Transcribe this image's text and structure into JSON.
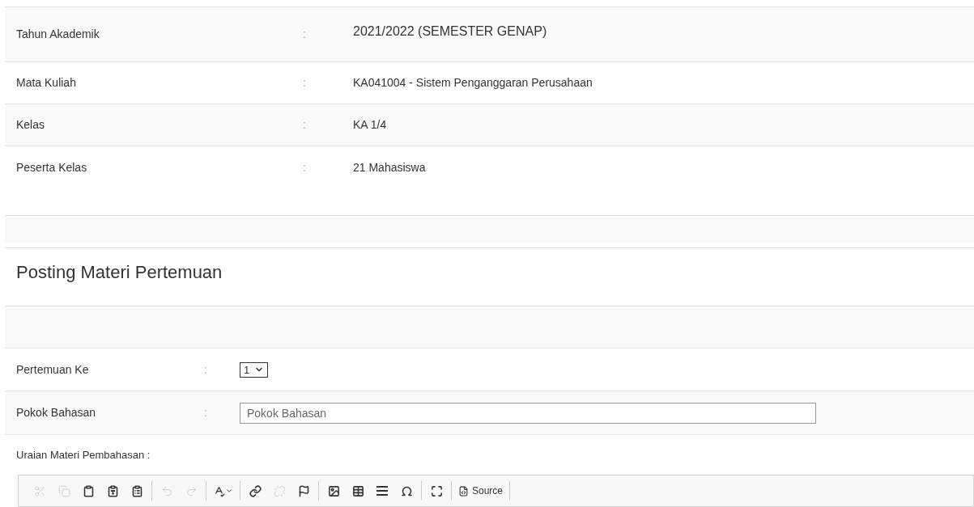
{
  "info_rows": [
    {
      "label": "Tahun Akademik",
      "separator": ":",
      "value": "2021/2022 (SEMESTER GENAP)"
    },
    {
      "label": "Mata Kuliah",
      "separator": ":",
      "value": "KA041004 - Sistem Penganggaran Perusahaan"
    },
    {
      "label": "Kelas",
      "separator": ":",
      "value": "KA 1/4"
    },
    {
      "label": "Peserta Kelas",
      "separator": ":",
      "value": "21 Mahasiswa"
    }
  ],
  "section_title": "Posting Materi Pertemuan",
  "form": {
    "meeting": {
      "label": "Pertemuan Ke",
      "separator": ":",
      "value": "1"
    },
    "topic": {
      "label": "Pokok Bahasan",
      "separator": ":",
      "placeholder": "Pokok Bahasan"
    },
    "description_label": "Uraian Materi Pembahasan :"
  },
  "toolbar": [
    [
      {
        "kind": "cut",
        "disabled": true
      },
      {
        "kind": "copy",
        "disabled": true
      },
      {
        "kind": "paste",
        "disabled": false
      },
      {
        "kind": "paste-text",
        "disabled": false
      },
      {
        "kind": "paste-word",
        "disabled": false
      }
    ],
    [
      {
        "kind": "undo",
        "disabled": true
      },
      {
        "kind": "redo",
        "disabled": true
      }
    ],
    [
      {
        "kind": "spellcheck",
        "disabled": false
      }
    ],
    [
      {
        "kind": "link",
        "disabled": false
      },
      {
        "kind": "unlink",
        "disabled": true
      },
      {
        "kind": "anchor",
        "disabled": false
      }
    ],
    [
      {
        "kind": "image",
        "disabled": false
      },
      {
        "kind": "table",
        "disabled": false
      },
      {
        "kind": "rule",
        "disabled": false
      },
      {
        "kind": "special-char",
        "disabled": false
      }
    ],
    [
      {
        "kind": "maximize",
        "disabled": false
      }
    ],
    [
      {
        "kind": "source",
        "disabled": false,
        "label": "Source"
      }
    ]
  ]
}
